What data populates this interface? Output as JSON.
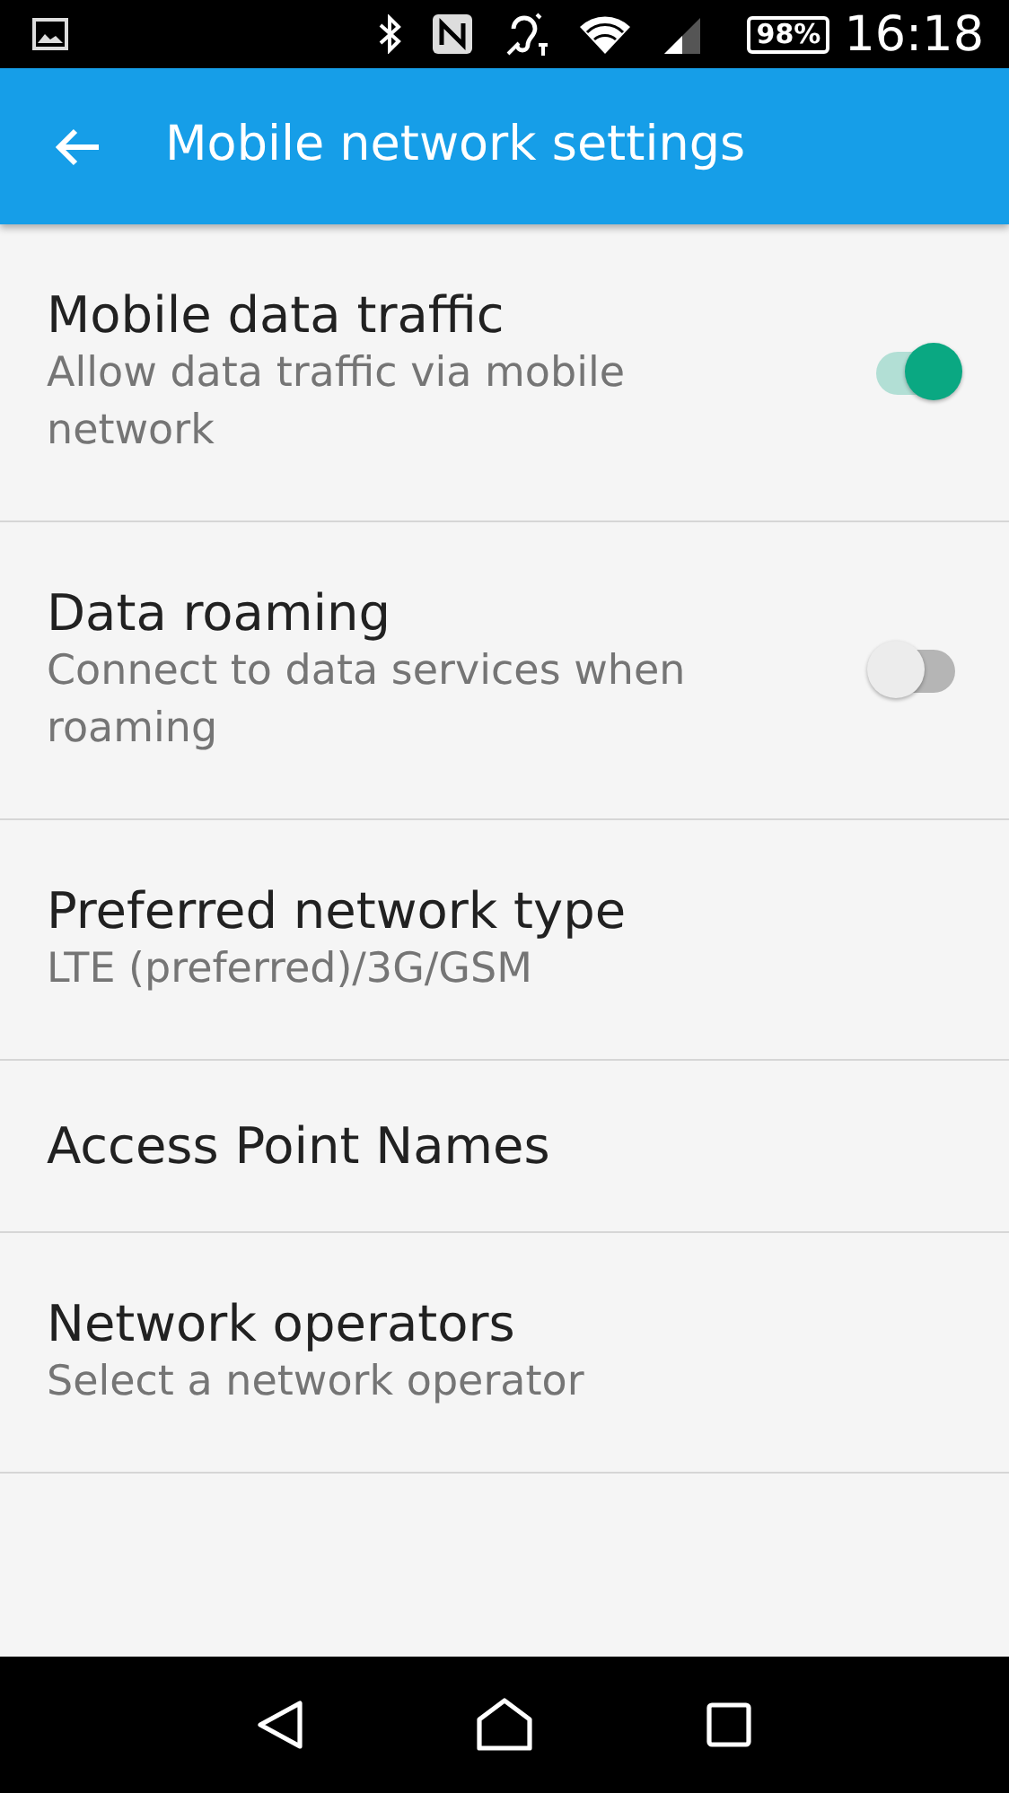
{
  "status_bar": {
    "battery": "98%",
    "time": "16:18"
  },
  "app_bar": {
    "title": "Mobile network settings"
  },
  "settings": [
    {
      "kind": "switch",
      "title": "Mobile data traffic",
      "summary": "Allow data traffic via mobile network",
      "on": true
    },
    {
      "kind": "switch",
      "title": "Data roaming",
      "summary": "Connect to data services when roaming",
      "on": false
    },
    {
      "kind": "plain",
      "title": "Preferred network type",
      "summary": "LTE (preferred)/3G/GSM"
    },
    {
      "kind": "plain",
      "title": "Access Point Names"
    },
    {
      "kind": "plain",
      "title": "Network operators",
      "summary": "Select a network operator"
    }
  ]
}
